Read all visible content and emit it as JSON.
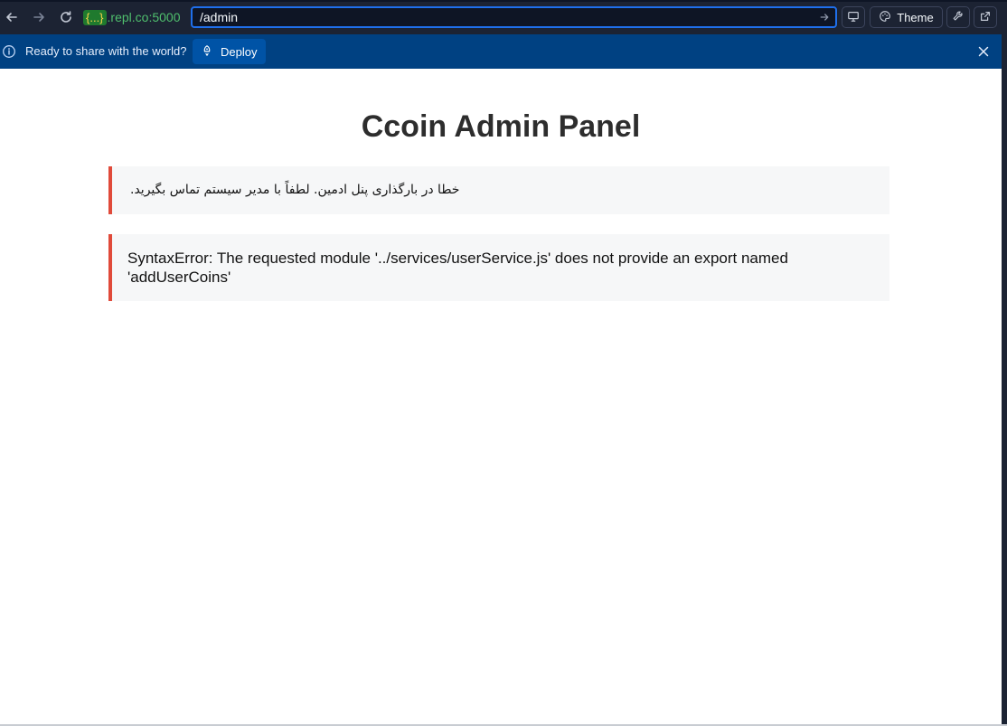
{
  "browser": {
    "url_prefix_braces": "{...}",
    "url_prefix_host": ".repl.co:5000",
    "url_path": "/admin",
    "theme_label": "Theme",
    "icons": {
      "back": "arrow-left-icon",
      "forward": "arrow-right-icon",
      "reload": "reload-icon",
      "go": "arrow-right-icon",
      "devtools": "monitor-icon",
      "theme": "palette-icon",
      "tools": "wrench-icon",
      "open_external": "external-link-icon"
    }
  },
  "banner": {
    "text": "Ready to share with the world?",
    "deploy_label": "Deploy",
    "icons": {
      "info": "info-icon",
      "deploy": "deploy-icon",
      "close": "close-icon"
    }
  },
  "page": {
    "title": "Ccoin Admin Panel",
    "alert_fa": "خطا در بارگذاری پنل ادمین. لطفاً با مدیر سیستم تماس بگیرید.",
    "alert_error": "SyntaxError: The requested module '../services/userService.js' does not provide an export named 'addUserCoins'"
  },
  "colors": {
    "toolbar_bg": "#1c2333",
    "banner_bg": "#004182",
    "deploy_bg": "#0053a6",
    "url_focus_border": "#1f6feb",
    "alert_border": "#e04a3a",
    "alert_bg": "#f6f7f8"
  }
}
